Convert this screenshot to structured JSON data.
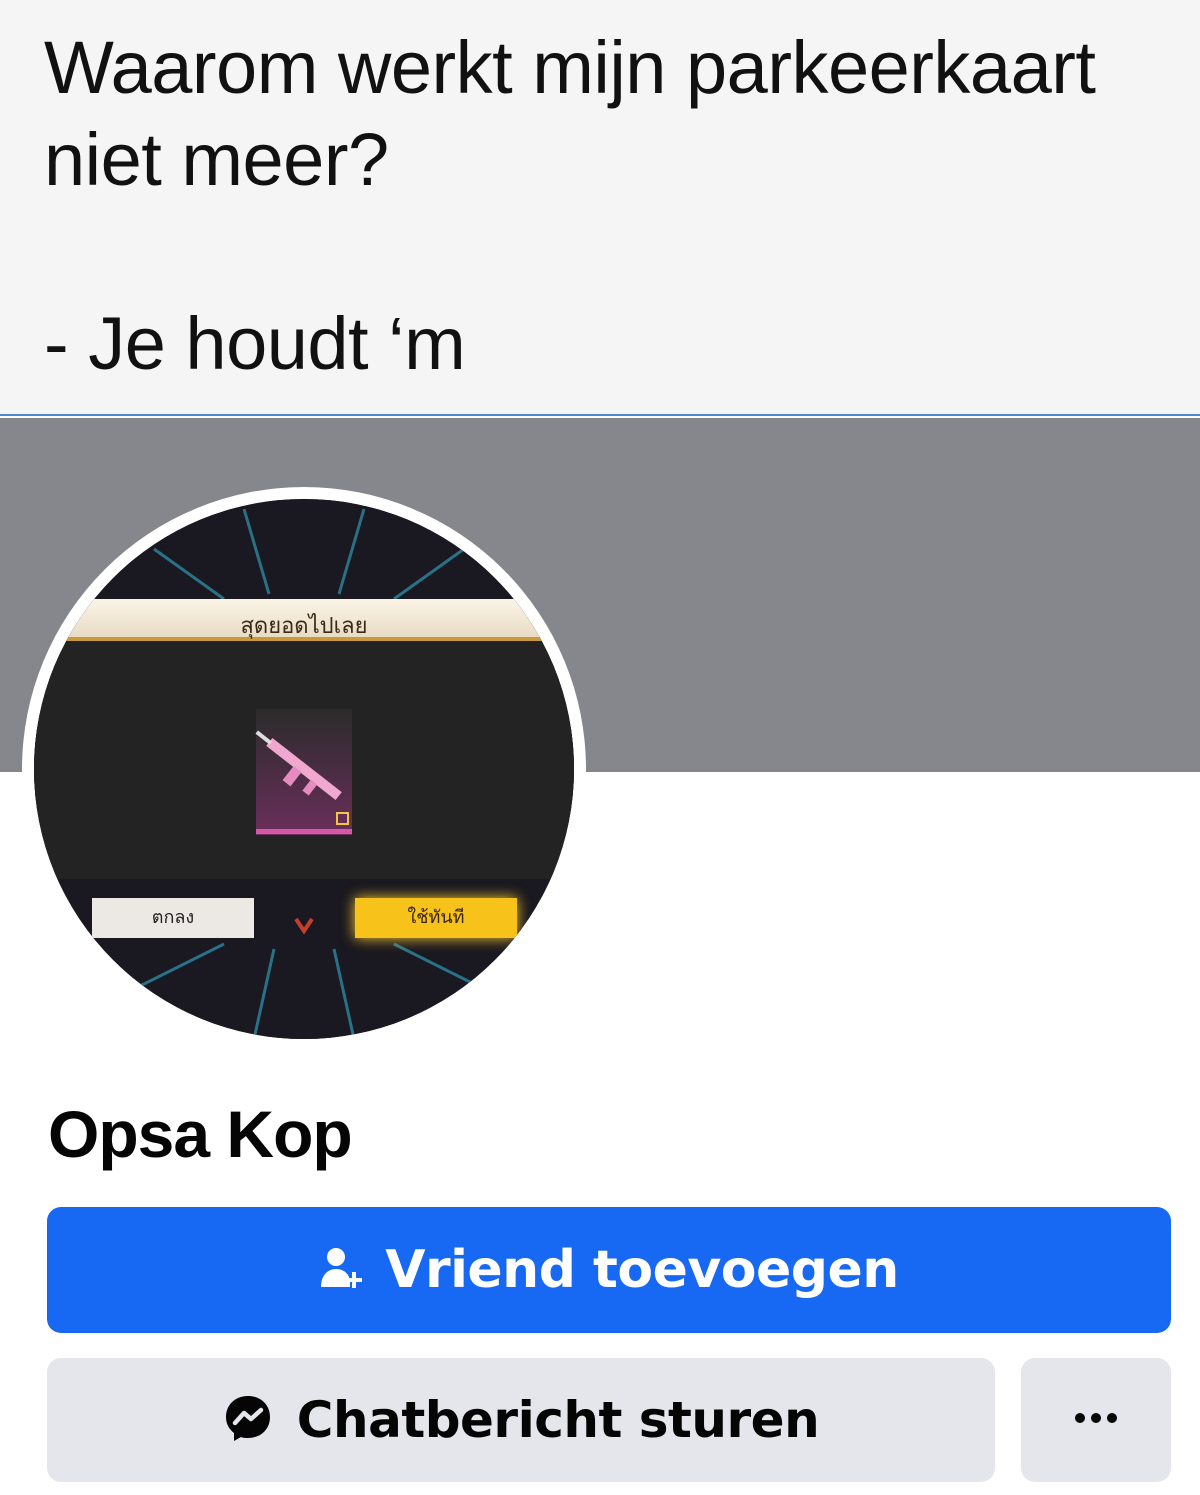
{
  "caption": {
    "line1": "Waarom werkt mijn parkeerkaart",
    "line2": "niet meer?",
    "line3": "- Je houdt ‘m"
  },
  "profile": {
    "name": "Opsa Kop",
    "avatar": {
      "banner_text": "สุดยอดไปเลย",
      "ok_button_label": "ตกลง",
      "use_button_label": "ใช้ทันที"
    }
  },
  "actions": {
    "add_friend_label": "Vriend toevoegen",
    "add_friend_icon": "add-person-icon",
    "chat_label": "Chatbericht sturen",
    "chat_icon": "messenger-icon",
    "more_icon": "more-dots-icon"
  },
  "colors": {
    "primary_button": "#1768f2",
    "secondary_button": "#e4e6eb",
    "cover": "#86878c"
  }
}
